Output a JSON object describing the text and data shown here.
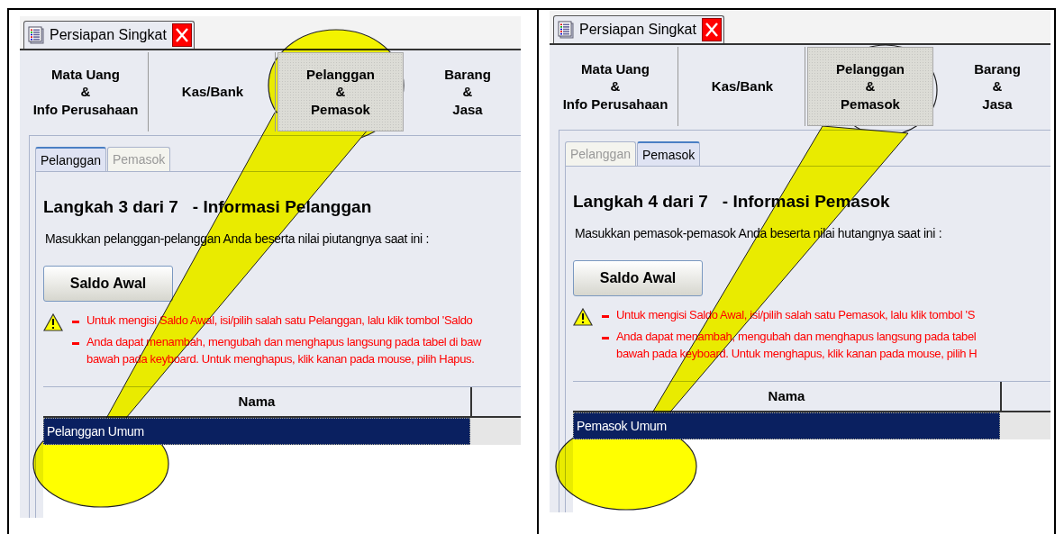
{
  "panels": [
    {
      "doc_tab": {
        "title": "Persiapan Singkat"
      },
      "steps": [
        {
          "label": "Mata Uang\n&\nInfo Perusahaan",
          "selected": false
        },
        {
          "label": "Kas/Bank",
          "selected": false
        },
        {
          "label": "Pelanggan\n&\nPemasok",
          "selected": true
        },
        {
          "label": "Barang\n&\nJasa",
          "selected": false
        }
      ],
      "subtabs": [
        {
          "label": "Pelanggan",
          "selected": true
        },
        {
          "label": "Pemasok",
          "selected": false
        }
      ],
      "heading": "Langkah 3 dari 7   - Informasi Pelanggan",
      "description": "Masukkan pelanggan-pelanggan Anda beserta nilai piutangnya saat ini :",
      "button": {
        "label": "Saldo Awal"
      },
      "notes": [
        {
          "lines": [
            "Untuk mengisi Saldo Awal, isi/pilih salah satu Pelanggan, lalu klik tombol 'Saldo"
          ]
        },
        {
          "lines": [
            "Anda dapat menambah, mengubah dan menghapus langsung pada tabel di baw",
            "bawah pada keyboard. Untuk menghapus, klik kanan pada mouse, pilih Hapus."
          ]
        }
      ],
      "table": {
        "columns": [
          "Nama"
        ],
        "rows": [
          {
            "cells": [
              "Pelanggan Umum"
            ],
            "selected": true
          }
        ]
      },
      "callout": {
        "target_filled": true
      }
    },
    {
      "doc_tab": {
        "title": "Persiapan Singkat"
      },
      "steps": [
        {
          "label": "Mata Uang\n&\nInfo Perusahaan",
          "selected": false
        },
        {
          "label": "Kas/Bank",
          "selected": false
        },
        {
          "label": "Pelanggan\n&\nPemasok",
          "selected": true
        },
        {
          "label": "Barang\n&\nJasa",
          "selected": false
        }
      ],
      "subtabs": [
        {
          "label": "Pelanggan",
          "selected": false
        },
        {
          "label": "Pemasok",
          "selected": true
        }
      ],
      "heading": "Langkah 4 dari 7   - Informasi Pemasok",
      "description": "Masukkan pemasok-pemasok Anda beserta nilai hutangnya saat ini :",
      "button": {
        "label": "Saldo Awal"
      },
      "notes": [
        {
          "lines": [
            "Untuk mengisi Saldo Awal, isi/pilih salah satu Pemasok, lalu klik tombol 'S"
          ]
        },
        {
          "lines": [
            "Anda dapat menambah, mengubah dan menghapus langsung pada tabel",
            "bawah pada keyboard. Untuk menghapus, klik kanan pada mouse, pilih H"
          ]
        }
      ],
      "table": {
        "columns": [
          "Nama"
        ],
        "rows": [
          {
            "cells": [
              "Pemasok Umum"
            ],
            "selected": true
          }
        ]
      },
      "callout": {
        "target_filled": false
      }
    }
  ]
}
